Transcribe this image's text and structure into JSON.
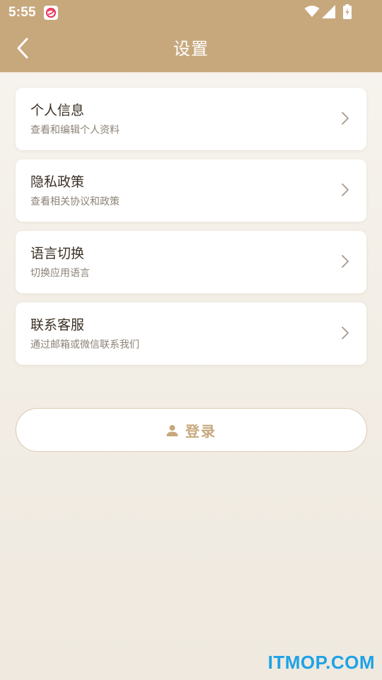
{
  "status_bar": {
    "time": "5:55"
  },
  "header": {
    "title": "设置"
  },
  "settings": {
    "items": [
      {
        "title": "个人信息",
        "subtitle": "查看和编辑个人资料"
      },
      {
        "title": "隐私政策",
        "subtitle": "查看相关协议和政策"
      },
      {
        "title": "语言切换",
        "subtitle": "切换应用语言"
      },
      {
        "title": "联系客服",
        "subtitle": "通过邮箱或微信联系我们"
      }
    ]
  },
  "login": {
    "label": "登录"
  },
  "watermark": {
    "text": "ITMOP.COM"
  },
  "colors": {
    "header": "#c7a87d",
    "accent": "#c7a87d",
    "title_text": "#3b3024",
    "subtitle_text": "#8c8378",
    "chevron": "#a8988a",
    "watermark": "#1ea3e6"
  },
  "icons": {
    "back": "chevron-left-icon",
    "row": "chevron-right-icon",
    "login": "user-icon",
    "wifi": "wifi-icon",
    "signal": "cellular-signal-icon",
    "battery": "battery-charging-icon"
  }
}
